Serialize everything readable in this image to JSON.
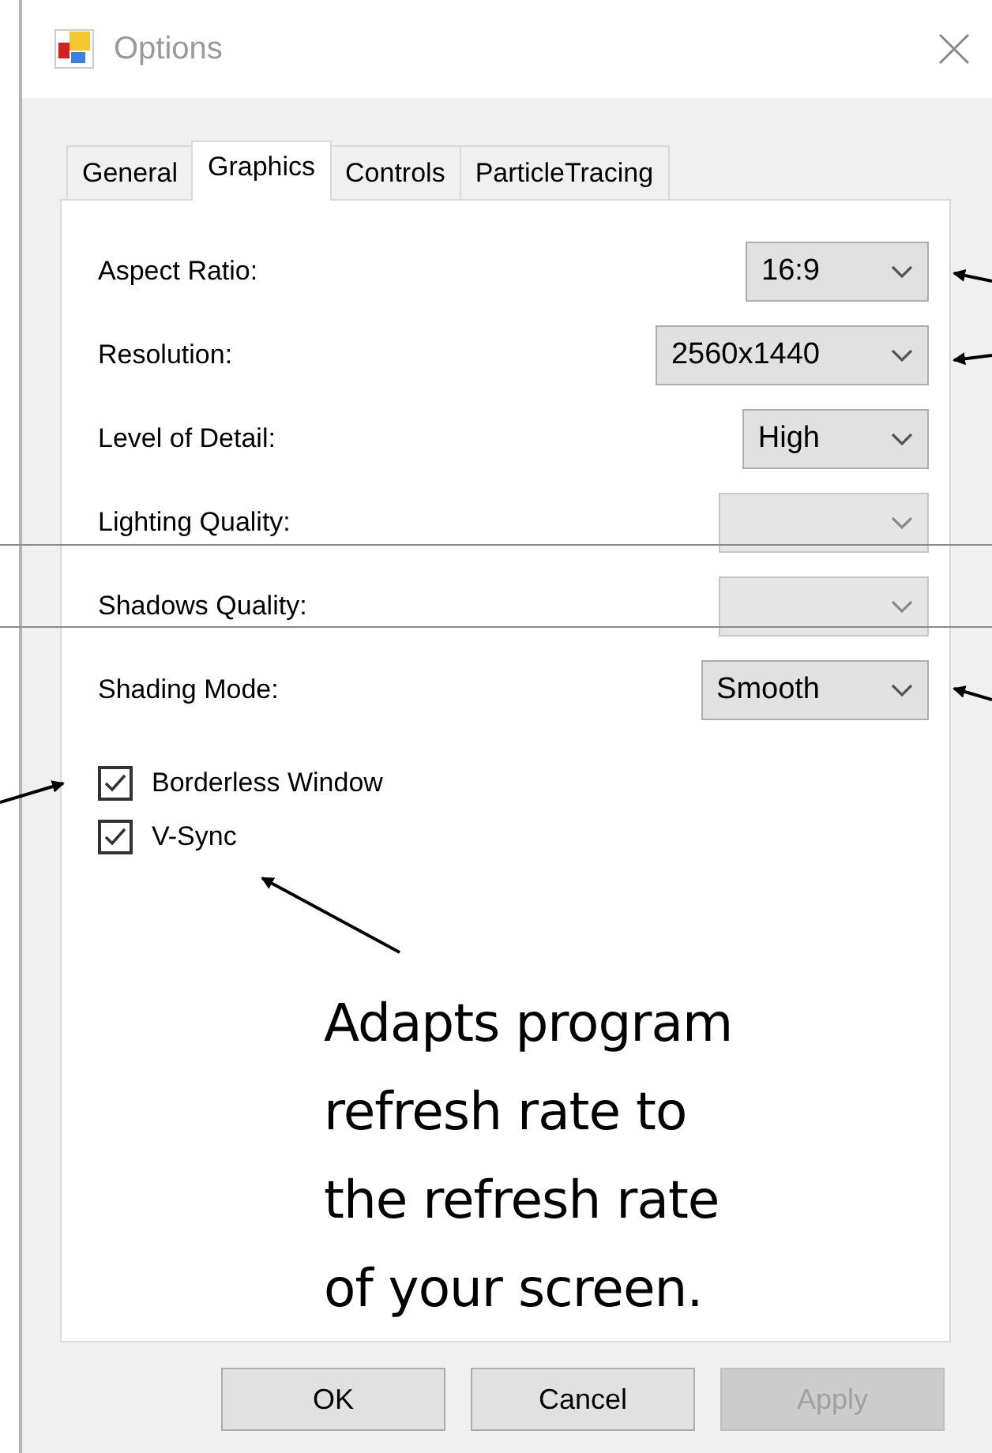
{
  "window": {
    "title": "Options"
  },
  "tabs": [
    {
      "label": "General",
      "selected": false
    },
    {
      "label": "Graphics",
      "selected": true
    },
    {
      "label": "Controls",
      "selected": false
    },
    {
      "label": "ParticleTracing",
      "selected": false
    }
  ],
  "settings": [
    {
      "label": "Aspect Ratio:",
      "value": "16:9",
      "disabled": false
    },
    {
      "label": "Resolution:",
      "value": "2560x1440",
      "disabled": false
    },
    {
      "label": "Level of Detail:",
      "value": "High",
      "disabled": false
    },
    {
      "label": "Lighting Quality:",
      "disabled": true
    },
    {
      "label": "Shadows Quality:",
      "disabled": true
    },
    {
      "label": "Shading Mode:",
      "value": "Smooth",
      "disabled": false
    }
  ],
  "checkboxes": [
    {
      "label": "Borderless Window",
      "checked": true
    },
    {
      "label": "V-Sync",
      "checked": true
    }
  ],
  "buttons": [
    {
      "label": "OK",
      "disabled": false
    },
    {
      "label": "Cancel",
      "disabled": false
    },
    {
      "label": "Apply",
      "disabled": true
    }
  ],
  "annotation": {
    "text": "Adapts program\nrefresh rate to\nthe refresh rate\nof your screen."
  }
}
